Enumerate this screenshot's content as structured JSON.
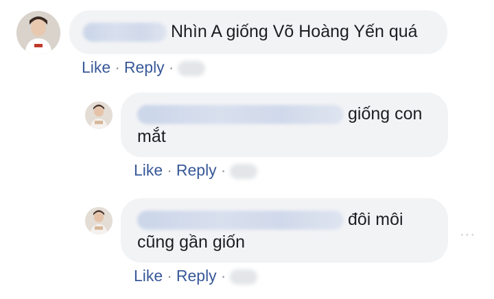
{
  "comments": [
    {
      "text": "Nhìn A giống Võ Hoàng Yến quá",
      "actions": {
        "like": "Like",
        "separator": "·",
        "reply": "Reply"
      }
    },
    {
      "text": "giống con mắt",
      "actions": {
        "like": "Like",
        "separator": "·",
        "reply": "Reply"
      }
    },
    {
      "text": "đôi môi cũng gần giốn",
      "actions": {
        "like": "Like",
        "separator": "·",
        "reply": "Reply"
      }
    }
  ],
  "more_icon": "···",
  "icons": {
    "more": "more-options-icon"
  },
  "colors": {
    "bubble": "#f2f3f5",
    "link": "#385898",
    "text": "#1c1e21"
  }
}
